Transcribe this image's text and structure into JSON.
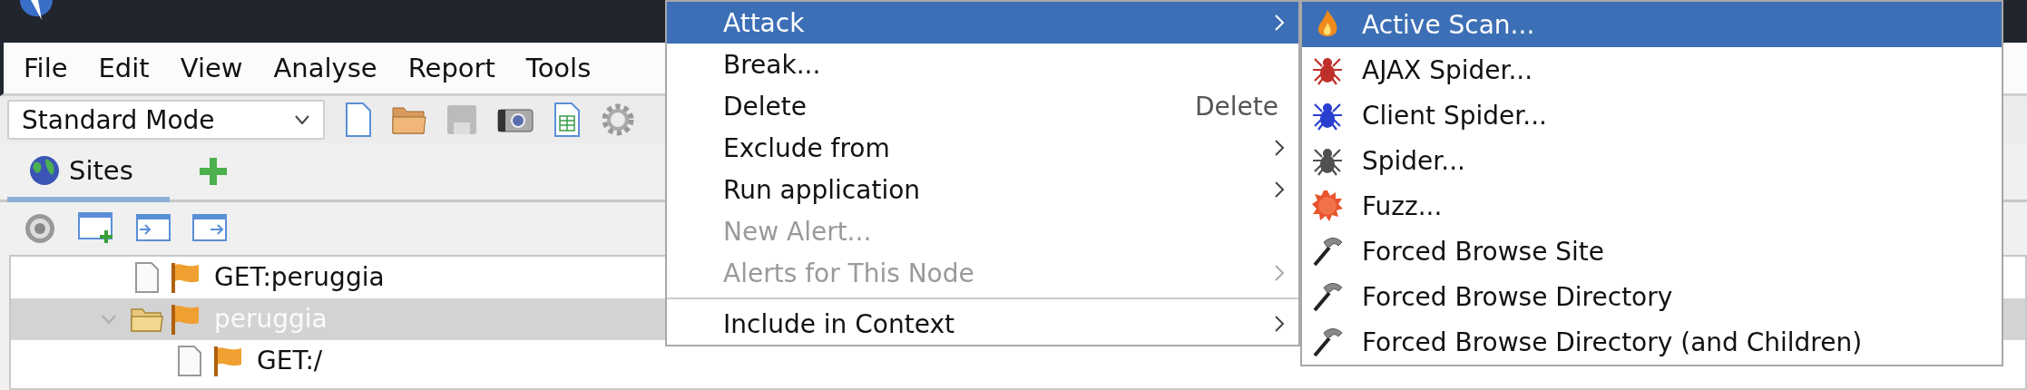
{
  "menu_bar": [
    "File",
    "Edit",
    "View",
    "Analyse",
    "Report",
    "Tools"
  ],
  "toolbar": {
    "mode": "Standard Mode"
  },
  "tabs": [
    {
      "label": "Sites",
      "selected": true
    }
  ],
  "tree": [
    {
      "label": "GET:peruggia",
      "kind": "page",
      "selected": false
    },
    {
      "label": "peruggia",
      "kind": "folder",
      "selected": true,
      "expanded": true,
      "children": [
        {
          "label": "GET:/",
          "kind": "page",
          "selected": false
        }
      ]
    }
  ],
  "context_menu": {
    "items": [
      {
        "label": "Attack",
        "submenu": true,
        "selected": true,
        "disabled": false
      },
      {
        "label": "Break...",
        "submenu": false,
        "selected": false,
        "disabled": false
      },
      {
        "label": "Delete",
        "shortcut": "Delete",
        "submenu": false,
        "selected": false,
        "disabled": false
      },
      {
        "label": "Exclude from",
        "submenu": true,
        "selected": false,
        "disabled": false
      },
      {
        "label": "Run application",
        "submenu": true,
        "selected": false,
        "disabled": false
      },
      {
        "label": "New Alert...",
        "submenu": false,
        "selected": false,
        "disabled": true
      },
      {
        "label": "Alerts for This Node",
        "submenu": true,
        "selected": false,
        "disabled": true
      },
      {
        "kind": "separator"
      },
      {
        "label": "Include in Context",
        "submenu": true,
        "selected": false,
        "disabled": false
      }
    ]
  },
  "attack_submenu": {
    "items": [
      {
        "label": "Active Scan...",
        "kind": "flame",
        "selected": true
      },
      {
        "label": "AJAX Spider...",
        "kind": "spider",
        "color": "#c0302a",
        "selected": false
      },
      {
        "label": "Client Spider...",
        "kind": "spider",
        "color": "#2a3fd0",
        "selected": false
      },
      {
        "label": "Spider...",
        "kind": "spider",
        "color": "#505050",
        "selected": false
      },
      {
        "label": "Fuzz...",
        "kind": "fuzz",
        "selected": false
      },
      {
        "label": "Forced Browse Site",
        "kind": "hammer",
        "selected": false
      },
      {
        "label": "Forced Browse Directory",
        "kind": "hammer",
        "selected": false
      },
      {
        "label": "Forced Browse Directory (and Children)",
        "kind": "hammer",
        "selected": false
      }
    ]
  }
}
